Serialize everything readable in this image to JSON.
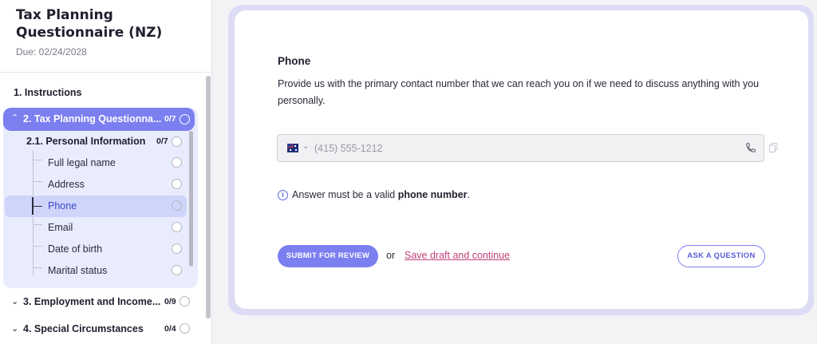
{
  "sidebar": {
    "title": "Tax Planning Questionnaire (NZ)",
    "due": "Due: 02/24/2028",
    "items": [
      {
        "label": "1. Instructions"
      },
      {
        "label": "2. Tax Planning Questionna...",
        "count": "0/7",
        "expanded": true,
        "subsection": {
          "label": "2.1. Personal Information",
          "count": "0/7",
          "leaves": [
            "Full legal name",
            "Address",
            "Phone",
            "Email",
            "Date of birth",
            "Marital status"
          ],
          "active_leaf": "Phone"
        }
      },
      {
        "label": "3. Employment and Income...",
        "count": "0/9"
      },
      {
        "label": "4. Special Circumstances",
        "count": "0/4"
      }
    ]
  },
  "question": {
    "title": "Phone",
    "description": "Provide us with the primary contact number that we can reach you on if we need to discuss anything with you personally.",
    "field": {
      "placeholder": "(415) 555-1212",
      "country_flag": "AU",
      "value": ""
    },
    "hint_prefix": "Answer must be a valid ",
    "hint_bold": "phone number",
    "hint_suffix": "."
  },
  "actions": {
    "submit_label": "SUBMIT FOR REVIEW",
    "or_text": "or",
    "save_label": "Save draft and continue",
    "ask_label": "ASK A QUESTION"
  },
  "colors": {
    "accent": "#7c7ff0",
    "link": "#c2417a",
    "active_bg": "#e9ecfd"
  },
  "icons": [
    "chevron-up-icon",
    "chevron-down-icon",
    "circle-status-icon",
    "au-flag-icon",
    "phone-icon",
    "copy-icon",
    "info-icon"
  ]
}
